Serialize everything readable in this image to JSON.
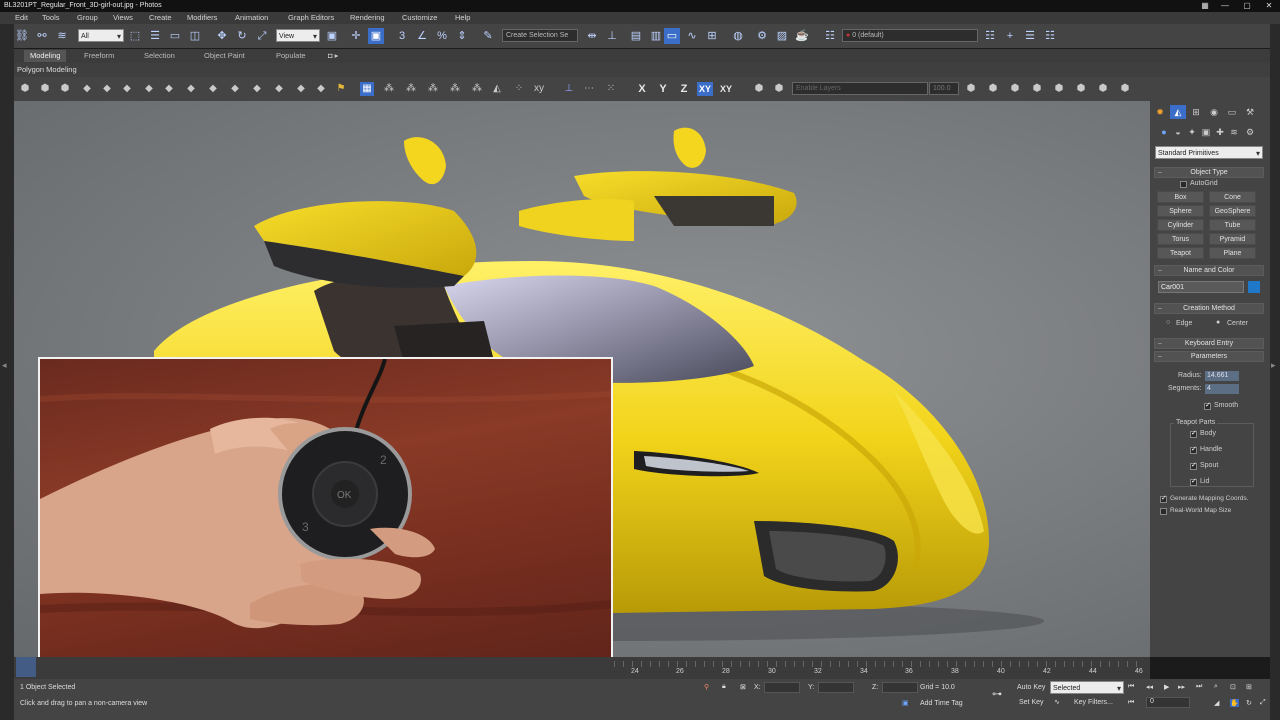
{
  "window": {
    "title": "BL3201PT_Regular_Front_3D-girl-out.jpg - Photos",
    "min": "—",
    "max": "▢",
    "close": "✕"
  },
  "menu": [
    "Edit",
    "Tools",
    "Group",
    "Views",
    "Create",
    "Modifiers",
    "Animation",
    "Graph Editors",
    "Rendering",
    "Customize",
    "Help"
  ],
  "main_toolbar": {
    "selection_filter": "All",
    "ref_coord": "View",
    "named_selection": "Create Selection Se",
    "layer": "0 (default)"
  },
  "ribbon_tabs": [
    "Modeling",
    "Freeform",
    "Selection",
    "Object Paint",
    "Populate"
  ],
  "ribbon_active": "Modeling",
  "polygon_modeling": "Polygon Modeling",
  "constraints": {
    "x": "X",
    "y": "Y",
    "z": "Z",
    "xy": "XY",
    "xy2": "XY"
  },
  "layer_field": "Enable Layers",
  "percent_value": "100.0",
  "command_panel": {
    "category": "Standard Primitives",
    "object_type_title": "Object Type",
    "autogrid": "AutoGrid",
    "buttons": [
      "Box",
      "Cone",
      "Sphere",
      "GeoSphere",
      "Cylinder",
      "Tube",
      "Torus",
      "Pyramid",
      "Teapot",
      "Plane"
    ],
    "name_color_title": "Name and Color",
    "object_name": "Car001",
    "object_color": "#1f78c8",
    "creation_method_title": "Creation Method",
    "edge": "Edge",
    "center": "Center",
    "keyboard_entry": "Keyboard Entry",
    "parameters_title": "Parameters",
    "radius_label": "Radius:",
    "radius_value": "14.661",
    "segments_label": "Segments:",
    "segments_value": "4",
    "smooth": "Smooth",
    "teapot_parts": "Teapot Parts",
    "parts": [
      "Body",
      "Handle",
      "Spout",
      "Lid"
    ],
    "gen_mapping": "Generate Mapping Coords.",
    "real_world": "Real-World Map Size"
  },
  "timeline_ticks": [
    "24",
    "26",
    "28",
    "30",
    "32",
    "34",
    "36",
    "38",
    "40",
    "42",
    "44",
    "46"
  ],
  "status": {
    "selected": "1 Object Selected",
    "prompt": "Click and drag to pan a non-camera view",
    "x_label": "X:",
    "y_label": "Y:",
    "z_label": "Z:",
    "grid": "Grid = 10.0",
    "add_time_tag": "Add Time Tag",
    "auto_key": "Auto Key",
    "set_key": "Set Key",
    "key_mode": "Selected",
    "key_filters": "Key Filters...",
    "frame": "0"
  },
  "remote": {
    "ok": "OK",
    "b2": "2",
    "b3": "3"
  }
}
